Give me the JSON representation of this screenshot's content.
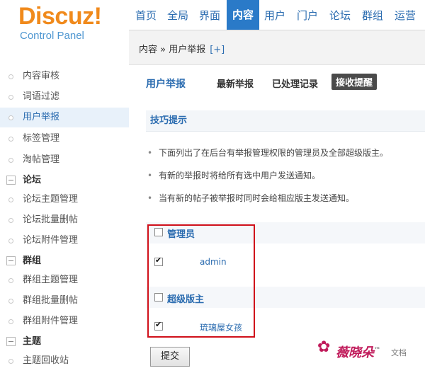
{
  "logo": {
    "brand": "Discuz!",
    "subtitle": "Control Panel"
  },
  "topnav": {
    "tabs": [
      "首页",
      "全局",
      "界面",
      "内容",
      "用户",
      "门户",
      "论坛",
      "群组",
      "运营"
    ],
    "active": "内容"
  },
  "breadcrumb": {
    "text": "内容 » 用户举报",
    "plus": "[+]"
  },
  "sidebar": {
    "items": [
      {
        "label": "内容审核"
      },
      {
        "label": "词语过滤"
      },
      {
        "label": "用户举报",
        "active": true
      },
      {
        "label": "标签管理"
      },
      {
        "label": "淘帖管理"
      }
    ],
    "groups": [
      {
        "title": "论坛",
        "items": [
          "论坛主题管理",
          "论坛批量删帖",
          "论坛附件管理"
        ]
      },
      {
        "title": "群组",
        "items": [
          "群组主题管理",
          "群组批量删帖",
          "群组附件管理"
        ]
      },
      {
        "title": "主题",
        "items": [
          "主题回收站"
        ]
      }
    ]
  },
  "main": {
    "title": "用户举报",
    "subtabs": [
      "最新举报",
      "已处理记录",
      "接收提醒"
    ],
    "current_subtab": "接收提醒",
    "tips_title": "技巧提示",
    "tips": [
      "下面列出了在后台有举报管理权限的管理员及全部超级版主。",
      "有新的举报时将给所有选中用户发送通知。",
      "当有新的帖子被举报时同时会给相应版主发送通知。"
    ],
    "groups": [
      {
        "label": "管理员",
        "checked": false,
        "users": [
          {
            "name": "admin",
            "checked": true
          }
        ]
      },
      {
        "label": "超级版主",
        "checked": false,
        "users": [
          {
            "name": "琉璃屋女孩",
            "checked": true
          }
        ]
      }
    ],
    "submit_label": "提交"
  },
  "watermark": {
    "text": "薇晓朵",
    "tm": "™",
    "sub": "文档"
  },
  "colors": {
    "accent": "#2a7ac8",
    "brand": "#f08a1c",
    "highlight": "#d0101a"
  }
}
